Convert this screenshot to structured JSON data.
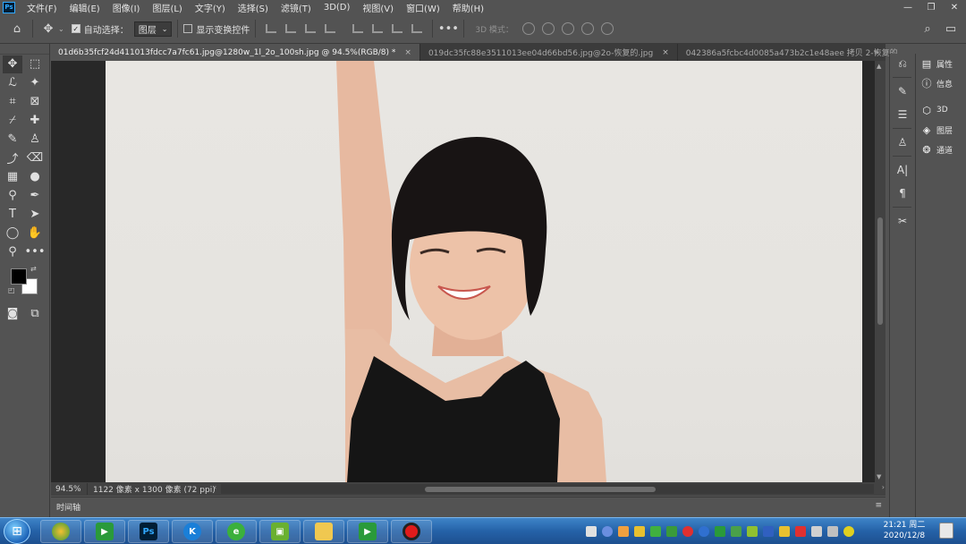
{
  "menu": {
    "logo": "Ps",
    "items": [
      "文件(F)",
      "编辑(E)",
      "图像(I)",
      "图层(L)",
      "文字(Y)",
      "选择(S)",
      "滤镜(T)",
      "3D(D)",
      "视图(V)",
      "窗口(W)",
      "帮助(H)"
    ]
  },
  "options": {
    "auto_select_label": "自动选择：",
    "auto_select_checked": true,
    "auto_select_value": "图层",
    "show_transform_label": "显示变换控件",
    "show_transform_checked": false,
    "mode_3d_label": "3D 模式："
  },
  "tabs": [
    {
      "label": "01d6b35fcf24d411013fdcc7a7fc61.jpg@1280w_1l_2o_100sh.jpg @ 94.5%(RGB/8) *",
      "active": true
    },
    {
      "label": "019dc35fc88e3511013ee04d66bd56.jpg@2o-恢复的.jpg",
      "active": false
    },
    {
      "label": "042386a5fcbc4d0085a473b2c1e48aee 拷贝 2-恢复的",
      "active": false
    }
  ],
  "status": {
    "zoom": "94.5%",
    "doc_size": "1122 像素 x 1300 像素 (72 ppi)"
  },
  "timeline": {
    "label": "时间轴"
  },
  "panels": [
    {
      "icon": "properties-icon",
      "label": "属性"
    },
    {
      "icon": "info-icon",
      "label": "信息"
    },
    {
      "icon": "3d-icon",
      "label": "3D"
    },
    {
      "icon": "layers-icon",
      "label": "图层"
    },
    {
      "icon": "channels-icon",
      "label": "通道"
    }
  ],
  "clock": {
    "time": "21:21 周二",
    "date": "2020/12/8"
  },
  "colors": {
    "foreground": "#000000",
    "background": "#ffffff",
    "ui_bg": "#535353"
  }
}
